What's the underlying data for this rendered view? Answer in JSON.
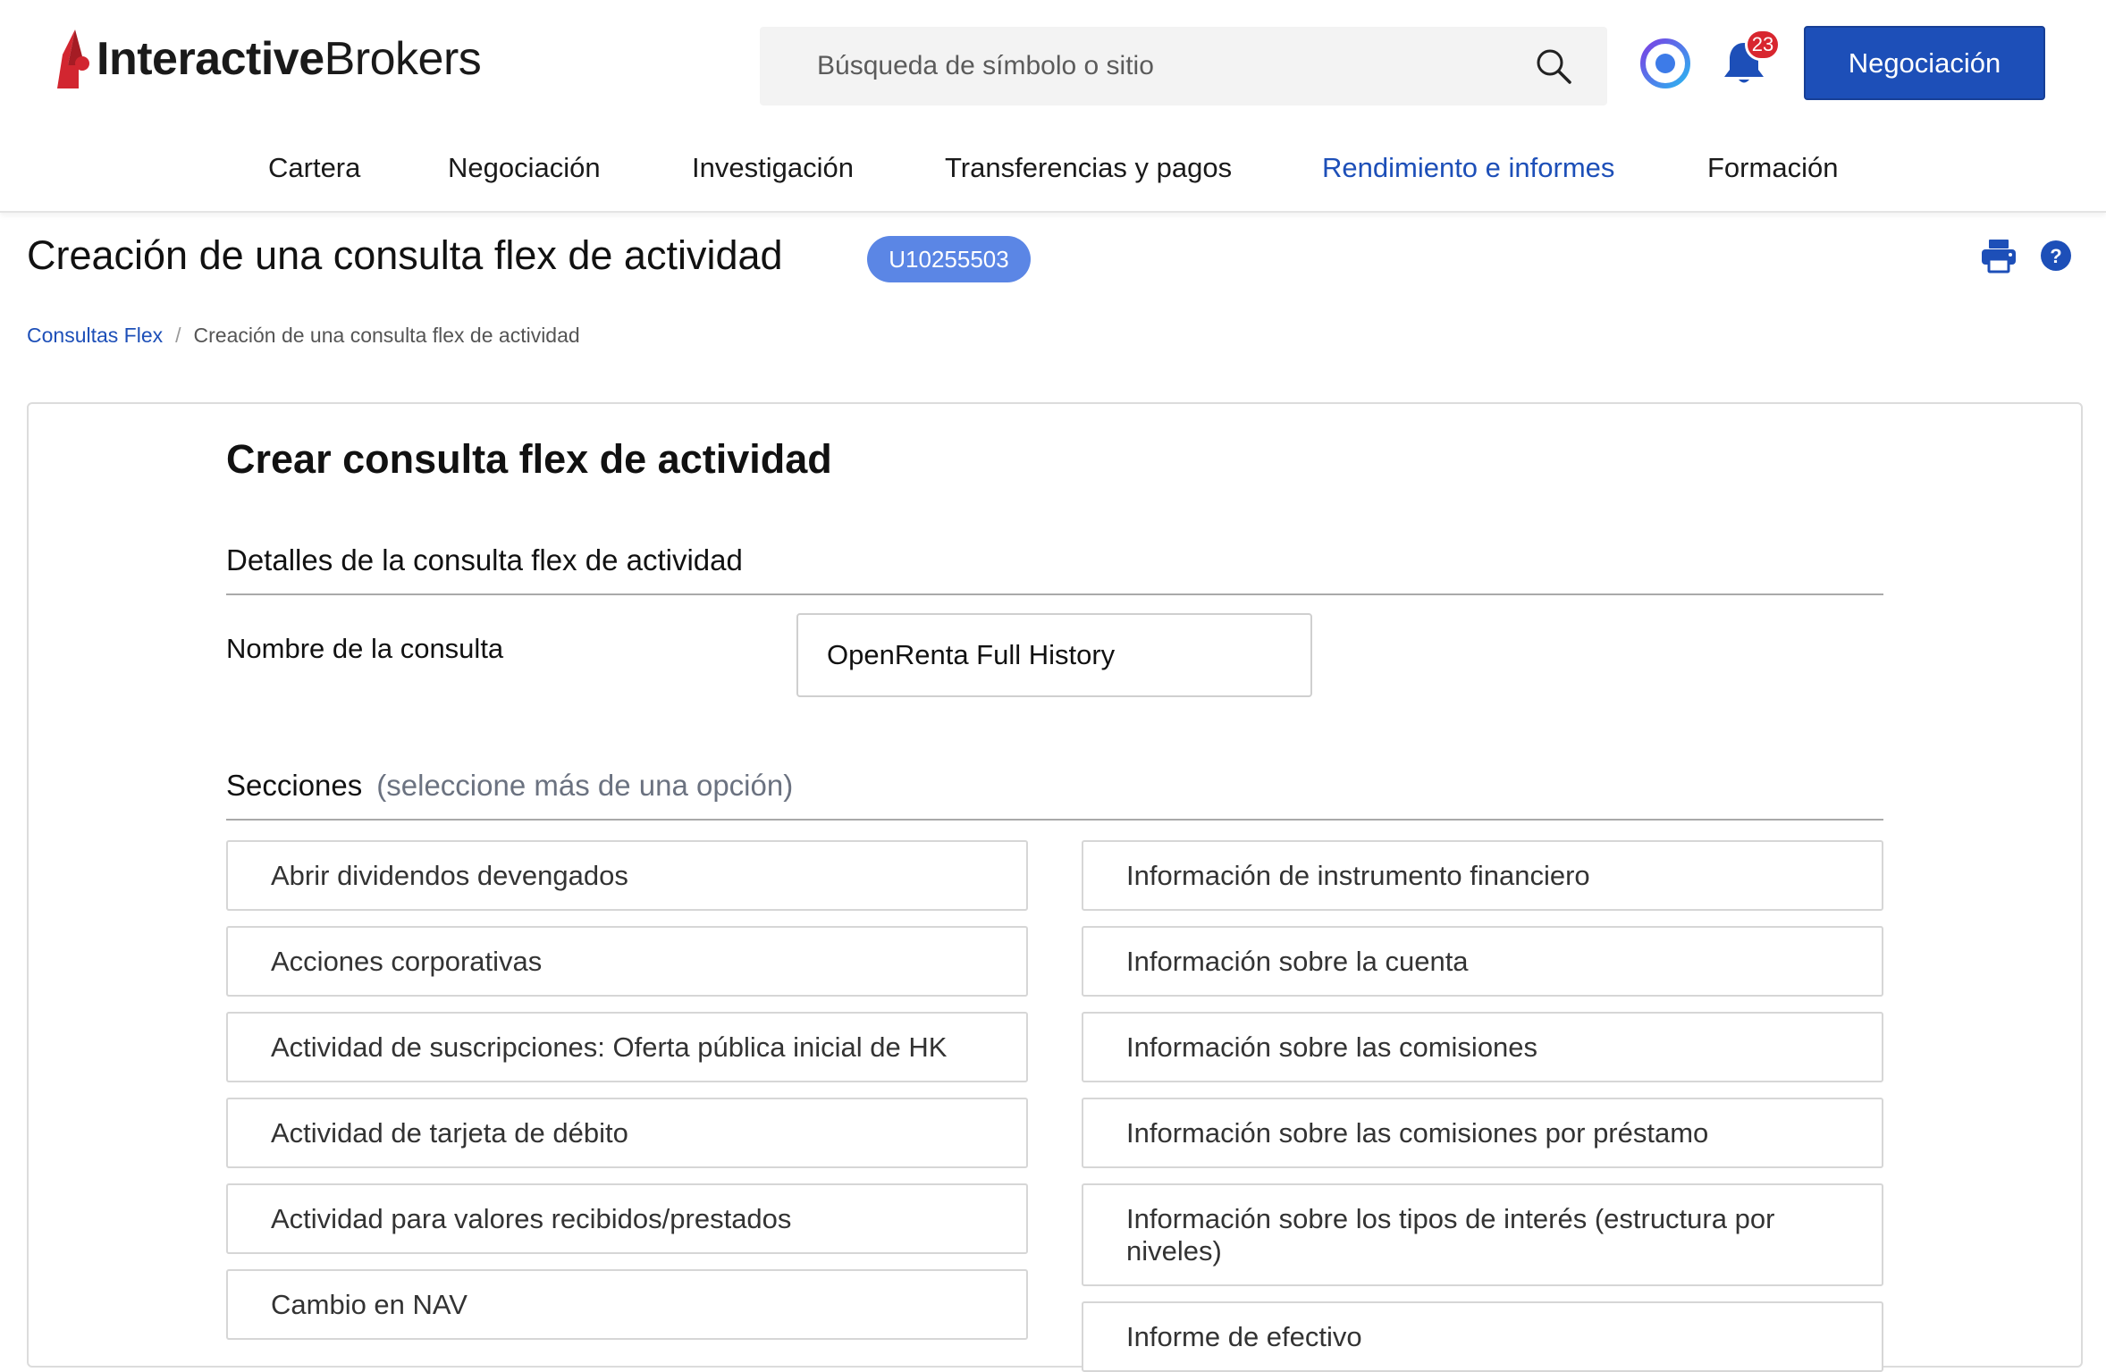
{
  "brand": {
    "name_bold": "Interactive",
    "name_light": "Brokers",
    "logo_color": "#d22630"
  },
  "header": {
    "search_placeholder": "Búsqueda de símbolo o sitio",
    "notification_count": "23",
    "trade_button": "Negociación",
    "icons": [
      "search-icon",
      "ibot-icon",
      "bell-icon"
    ]
  },
  "nav": {
    "items": [
      {
        "label": "Cartera"
      },
      {
        "label": "Negociación"
      },
      {
        "label": "Investigación"
      },
      {
        "label": "Transferencias y pagos"
      },
      {
        "label": "Rendimiento e informes",
        "active": true
      },
      {
        "label": "Formación"
      }
    ]
  },
  "page": {
    "title": "Creación de una consulta flex de actividad",
    "account_id": "U10255503",
    "breadcrumb": {
      "parent": "Consultas Flex",
      "separator": "/",
      "current": "Creación de una consulta flex de actividad"
    }
  },
  "form": {
    "card_title": "Crear consulta flex de actividad",
    "details_heading": "Detalles de la consulta flex de actividad",
    "name_label": "Nombre de la consulta",
    "name_value": "OpenRenta Full History",
    "sections_heading": "Secciones",
    "sections_hint": "(seleccione más de una opción)",
    "left_options": [
      "Abrir dividendos devengados",
      "Acciones corporativas",
      "Actividad de suscripciones: Oferta pública inicial de HK",
      "Actividad de tarjeta de débito",
      "Actividad para valores recibidos/prestados",
      "Cambio en NAV"
    ],
    "right_options": [
      "Información de instrumento financiero",
      "Información sobre la cuenta",
      "Información sobre las comisiones",
      "Información sobre las comisiones por préstamo",
      "Información sobre los tipos de interés (estructura por niveles)",
      "Informe de efectivo"
    ]
  },
  "colors": {
    "primary": "#1d4fb8",
    "badge": "#5b86e5",
    "notification": "#d8262f"
  }
}
